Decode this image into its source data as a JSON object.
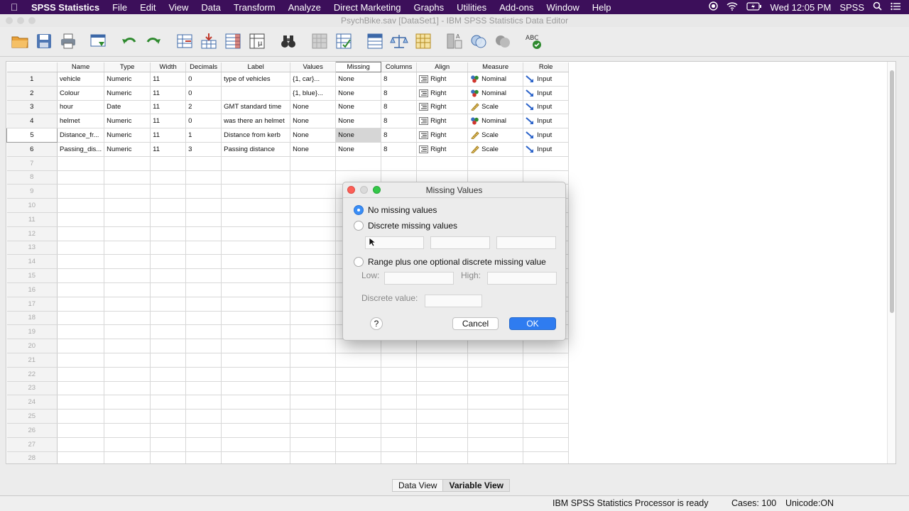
{
  "menubar": {
    "app_name": "SPSS Statistics",
    "items": [
      "File",
      "Edit",
      "View",
      "Data",
      "Transform",
      "Analyze",
      "Direct Marketing",
      "Graphs",
      "Utilities",
      "Add-ons",
      "Window",
      "Help"
    ],
    "clock": "Wed 12:05 PM",
    "user": "SPSS"
  },
  "window": {
    "title": "PsychBike.sav [DataSet1] - IBM SPSS Statistics Data Editor"
  },
  "grid": {
    "headers": [
      "Name",
      "Type",
      "Width",
      "Decimals",
      "Label",
      "Values",
      "Missing",
      "Columns",
      "Align",
      "Measure",
      "Role"
    ],
    "rows": [
      {
        "num": "1",
        "name": "vehicle",
        "type": "Numeric",
        "width": "11",
        "decimals": "0",
        "label": "type of vehicles",
        "values": "{1, car}...",
        "missing": "None",
        "columns": "8",
        "align": "Right",
        "measure": "Nominal",
        "measure_icon": "nominal-icon",
        "role": "Input"
      },
      {
        "num": "2",
        "name": "Colour",
        "type": "Numeric",
        "width": "11",
        "decimals": "0",
        "label": "",
        "values": "{1, blue}...",
        "missing": "None",
        "columns": "8",
        "align": "Right",
        "measure": "Nominal",
        "measure_icon": "nominal-icon",
        "role": "Input"
      },
      {
        "num": "3",
        "name": "hour",
        "type": "Date",
        "width": "11",
        "decimals": "2",
        "label": "GMT standard time",
        "values": "None",
        "missing": "None",
        "columns": "8",
        "align": "Right",
        "measure": "Scale",
        "measure_icon": "scale-ruler-icon",
        "role": "Input"
      },
      {
        "num": "4",
        "name": "helmet",
        "type": "Numeric",
        "width": "11",
        "decimals": "0",
        "label": "was there an helmet",
        "values": "None",
        "missing": "None",
        "columns": "8",
        "align": "Right",
        "measure": "Nominal",
        "measure_icon": "nominal-icon",
        "role": "Input"
      },
      {
        "num": "5",
        "name": "Distance_fr...",
        "type": "Numeric",
        "width": "11",
        "decimals": "1",
        "label": "Distance from kerb",
        "values": "None",
        "missing": "None",
        "columns": "8",
        "align": "Right",
        "measure": "Scale",
        "measure_icon": "scale-ruler-icon",
        "role": "Input"
      },
      {
        "num": "6",
        "name": "Passing_dis...",
        "type": "Numeric",
        "width": "11",
        "decimals": "3",
        "label": "Passing distance",
        "values": "None",
        "missing": "None",
        "columns": "8",
        "align": "Right",
        "measure": "Scale",
        "measure_icon": "scale-ruler-icon",
        "role": "Input"
      }
    ],
    "empty_rows": [
      "7",
      "8",
      "9",
      "10",
      "11",
      "12",
      "13",
      "14",
      "15",
      "16",
      "17",
      "18",
      "19",
      "20",
      "21",
      "22",
      "23",
      "24",
      "25",
      "26",
      "27",
      "28"
    ],
    "selected_row": "5",
    "selected_column": "Missing"
  },
  "dialog": {
    "title": "Missing Values",
    "option_none": "No missing values",
    "option_discrete": "Discrete missing values",
    "option_range": "Range plus one optional discrete missing value",
    "low_label": "Low:",
    "high_label": "High:",
    "discrete_value_label": "Discrete value:",
    "help_label": "?",
    "cancel_label": "Cancel",
    "ok_label": "OK",
    "selected_option": "none"
  },
  "tabs": [
    {
      "label": "Data View",
      "active": false
    },
    {
      "label": "Variable View",
      "active": true
    }
  ],
  "status": {
    "processor": "IBM SPSS Statistics Processor is ready",
    "cases": "Cases: 100",
    "unicode": "Unicode:ON"
  },
  "colors": {
    "menubar_bg": "#3c0f5a",
    "ok_blue": "#2f7cf0",
    "radio_blue": "#3a8ef6"
  }
}
